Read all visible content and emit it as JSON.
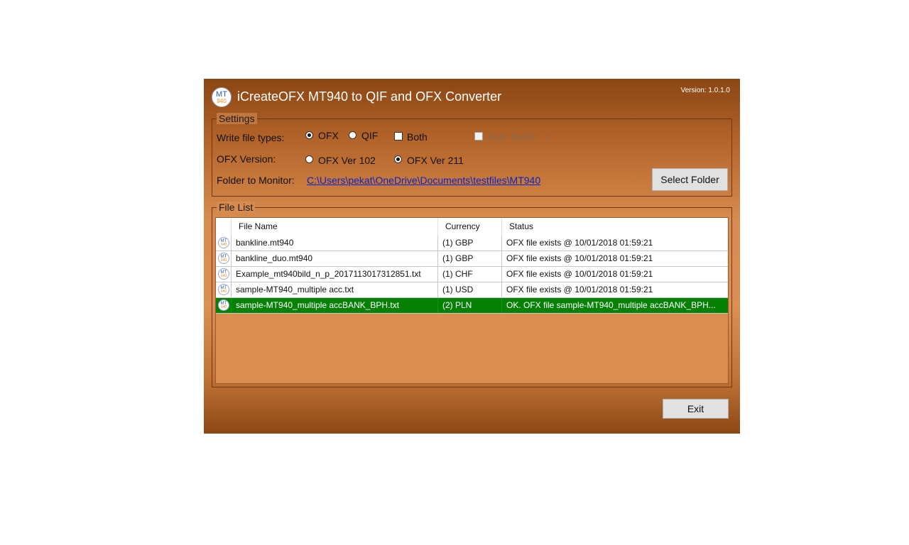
{
  "app": {
    "logo_top": "MT",
    "logo_bottom": "940",
    "title": "iCreateOFX MT940 to QIF and OFX Converter",
    "version": "Version: 1.0.1.0"
  },
  "settings": {
    "legend": "Settings",
    "write_types_label": "Write file types:",
    "ofx_label": "OFX",
    "qif_label": "QIF",
    "both_label": "Both",
    "auto_notify_label": "Auto Notify",
    "auto_notify_suffix": "/",
    "ofx_version_label": "OFX Version:",
    "ver102_label": "OFX Ver 102",
    "ver211_label": "OFX Ver 211",
    "folder_label": "Folder to Monitor:",
    "folder_path": "C:\\Users\\pekat\\OneDrive\\Documents\\testfiles\\MT940",
    "select_folder_label": "Select Folder"
  },
  "file_list": {
    "legend": "File List",
    "columns": [
      "File Name",
      "Currency",
      "Status"
    ],
    "rows": [
      {
        "name": "bankline.mt940",
        "currency": "(1) GBP",
        "status": "OFX file exists @ 10/01/2018 01:59:21"
      },
      {
        "name": "bankline_duo.mt940",
        "currency": "(1) GBP",
        "status": "OFX file exists @ 10/01/2018 01:59:21"
      },
      {
        "name": "Example_mt940bild_n_p_2017113017312851.txt",
        "currency": "(1) CHF",
        "status": "OFX file exists @ 10/01/2018 01:59:21"
      },
      {
        "name": "sample-MT940_multiple acc.txt",
        "currency": "(1) USD",
        "status": "OFX file exists @ 10/01/2018 01:59:21"
      },
      {
        "name": "sample-MT940_multiple accBANK_BPH.txt",
        "currency": "(2) PLN",
        "status": "OK. OFX file sample-MT940_multiple accBANK_BPH..."
      }
    ]
  },
  "footer": {
    "exit_label": "Exit"
  },
  "colors": {
    "selected_row": "#078006",
    "window_top": "#8a4613",
    "window_mid": "#dc8f52"
  }
}
